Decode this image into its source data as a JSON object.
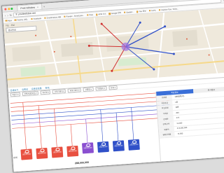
{
  "browser": {
    "tab_title": "Print Window",
    "new_tab": "+",
    "url": "① ymoleetidee.net",
    "bookmarks": [
      "Apps",
      "Factory | BD..",
      "Facebook",
      "SmartFactory NBI",
      "Pioneer - SmartLeas..",
      "Pack",
      "APM 시스",
      "Google 번역",
      "Geolad ..",
      "Flux 정보",
      "hLPC",
      "Fashion Tips, Tricks.."
    ],
    "colors": {
      "dot_red": "#ff5f57",
      "dot_yellow": "#febc2e",
      "dot_green": "#28c840"
    }
  },
  "map": {
    "menu_text": "지도 · 위성",
    "search_value": "경로안내"
  },
  "content": {
    "tabs": [
      "전체보기",
      "유통망",
      "유통망흐름",
      "판매"
    ],
    "filters": [
      "회원사 ▾",
      "판매처(점포명) ▾",
      "회사명 ▾",
      "상위거래처 ▾",
      "하위거래처 ▾",
      "상품명 ▾",
      "거래일자 ▾",
      "합계 ▾"
    ],
    "left_label": "합계",
    "total": "288,000,000",
    "nodes": [
      {
        "label": "2019.02",
        "sub": "288,000,000",
        "color": "#e85040"
      },
      {
        "label": "2019.02",
        "sub": "288,000,000",
        "color": "#e85040"
      },
      {
        "label": "2019.02",
        "sub": "288,000,000",
        "color": "#e85040"
      },
      {
        "label": "2019.02",
        "sub": "288,000,000",
        "color": "#e85040"
      },
      {
        "label": "판매처",
        "sub": "288,000,000",
        "color": "#8a4fd0"
      },
      {
        "label": "2019.02",
        "sub": "288,000,000",
        "color": "#3050c8"
      },
      {
        "label": "2019.02",
        "sub": "288,000,000",
        "color": "#3050c8"
      },
      {
        "label": "2019.02",
        "sub": "288,000,000",
        "color": "#3050c8"
      }
    ],
    "detail": {
      "headers": [
        "회원정보",
        "회사정보"
      ],
      "rows": [
        {
          "key": "업체명",
          "value": "대한물류(주)"
        },
        {
          "key": "회원등급",
          "value": "1등"
        },
        {
          "key": "회원유형",
          "value": "유통"
        },
        {
          "key": "거래량",
          "value": "400"
        },
        {
          "key": "판매량",
          "value": "273"
        },
        {
          "key": "판매금액",
          "value": "12,000"
        },
        {
          "key": "매출액",
          "value": "474,000,000"
        },
        {
          "key": "월평균매출",
          "value": "74,000"
        }
      ]
    }
  }
}
